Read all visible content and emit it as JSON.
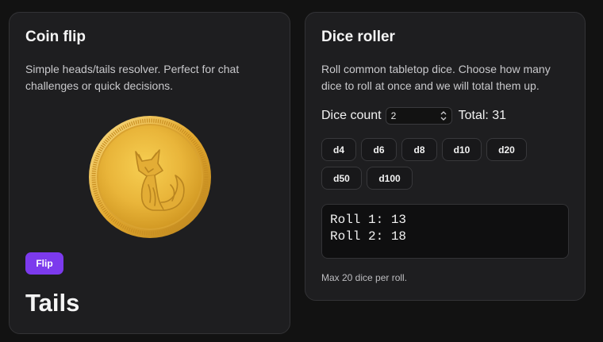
{
  "coin_card": {
    "title": "Coin flip",
    "description": "Simple heads/tails resolver. Perfect for chat challenges or quick decisions.",
    "coin_icon": "fox-coin-icon",
    "flip_label": "Flip",
    "result": "Tails"
  },
  "dice_card": {
    "title": "Dice roller",
    "description": "Roll common tabletop dice. Choose how many dice to roll at once and we will total them up.",
    "count_label": "Dice count",
    "count_value": "2",
    "total_text": "Total: 31",
    "dice": [
      "d4",
      "d6",
      "d8",
      "d10",
      "d20",
      "d50",
      "d100"
    ],
    "rolls": [
      "Roll 1: 13",
      "Roll 2: 18"
    ],
    "note": "Max 20 dice per roll."
  },
  "colors": {
    "background": "#121212",
    "card": "#1e1e20",
    "accent": "#7c3aed",
    "coin_gold": "#e9b53a"
  }
}
